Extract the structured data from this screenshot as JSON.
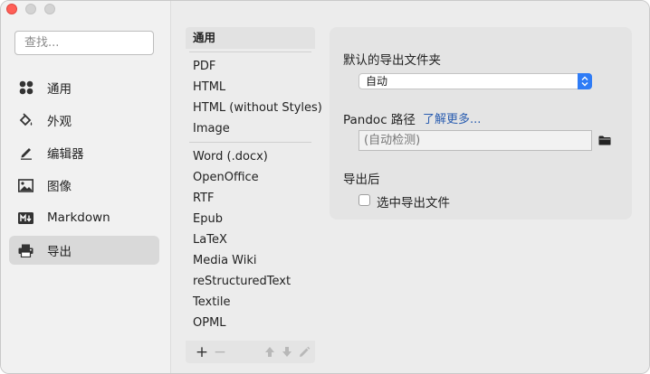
{
  "window": {
    "controls": [
      "close",
      "minimize",
      "maximize"
    ]
  },
  "sidebar": {
    "search_placeholder": "查找...",
    "items": [
      {
        "label": "通用",
        "icon": "general-icon",
        "active": false
      },
      {
        "label": "外观",
        "icon": "appearance-icon",
        "active": false
      },
      {
        "label": "编辑器",
        "icon": "editor-icon",
        "active": false
      },
      {
        "label": "图像",
        "icon": "image-icon",
        "active": false
      },
      {
        "label": "Markdown",
        "icon": "markdown-icon",
        "active": false
      },
      {
        "label": "导出",
        "icon": "export-icon",
        "active": true
      }
    ]
  },
  "export_list": {
    "header": "通用",
    "group1": [
      "PDF",
      "HTML",
      "HTML (without Styles)",
      "Image"
    ],
    "group2": [
      "Word (.docx)",
      "OpenOffice",
      "RTF",
      "Epub",
      "LaTeX",
      "Media Wiki",
      "reStructuredText",
      "Textile",
      "OPML"
    ],
    "footer": {
      "add": "+",
      "remove": "−"
    }
  },
  "settings": {
    "default_folder_label": "默认的导出文件夹",
    "default_folder_value": "自动",
    "pandoc_label": "Pandoc 路径",
    "learn_more": "了解更多...",
    "pandoc_placeholder": "(自动检测)",
    "after_export_label": "导出后",
    "reveal_checkbox_label": "选中导出文件",
    "reveal_checked": false
  },
  "colors": {
    "accent": "#2f7cf6",
    "link": "#2a5db0",
    "close_button": "#ff5f57"
  }
}
